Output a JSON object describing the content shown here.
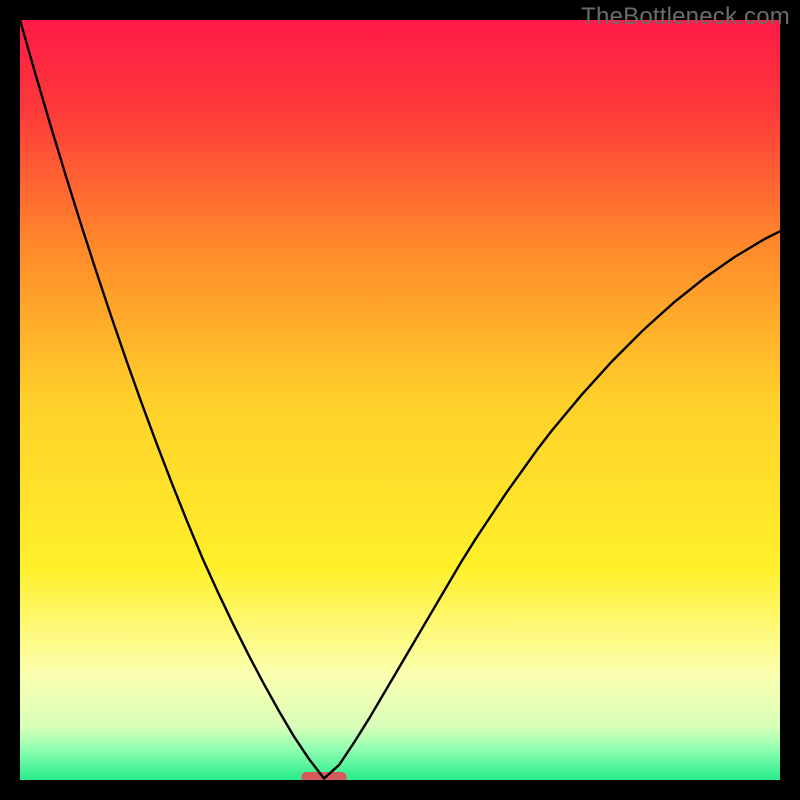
{
  "watermark": "TheBottleneck.com",
  "chart_data": {
    "type": "line",
    "title": "",
    "xlabel": "",
    "ylabel": "",
    "xlim": [
      0,
      100
    ],
    "ylim": [
      0,
      100
    ],
    "grid": false,
    "background": {
      "description": "vertical gradient red→orange→yellow→pale→green (top→bottom)",
      "stops": [
        {
          "pct": 0,
          "color": "#ff1a47"
        },
        {
          "pct": 12,
          "color": "#ff3a3a"
        },
        {
          "pct": 30,
          "color": "#ff8a2a"
        },
        {
          "pct": 50,
          "color": "#ffd02a"
        },
        {
          "pct": 72,
          "color": "#fff02a"
        },
        {
          "pct": 86,
          "color": "#fcffb0"
        },
        {
          "pct": 93,
          "color": "#d8ffb9"
        },
        {
          "pct": 96,
          "color": "#8effb0"
        },
        {
          "pct": 100,
          "color": "#28ec8c"
        }
      ]
    },
    "cusp_marker": {
      "x": 40,
      "y": 0,
      "width": 6,
      "color": "#d85a5a",
      "shape": "rounded-dash"
    },
    "series": [
      {
        "name": "bottleneck-curve",
        "color": "#000000",
        "points": [
          {
            "x": 0.0,
            "y": 100.0
          },
          {
            "x": 2.0,
            "y": 93.0
          },
          {
            "x": 4.0,
            "y": 86.2
          },
          {
            "x": 6.0,
            "y": 79.6
          },
          {
            "x": 8.0,
            "y": 73.2
          },
          {
            "x": 10.0,
            "y": 67.0
          },
          {
            "x": 12.0,
            "y": 61.0
          },
          {
            "x": 14.0,
            "y": 55.2
          },
          {
            "x": 16.0,
            "y": 49.6
          },
          {
            "x": 18.0,
            "y": 44.2
          },
          {
            "x": 20.0,
            "y": 39.0
          },
          {
            "x": 22.0,
            "y": 34.0
          },
          {
            "x": 24.0,
            "y": 29.2
          },
          {
            "x": 26.0,
            "y": 24.8
          },
          {
            "x": 28.0,
            "y": 20.6
          },
          {
            "x": 30.0,
            "y": 16.6
          },
          {
            "x": 32.0,
            "y": 12.8
          },
          {
            "x": 34.0,
            "y": 9.2
          },
          {
            "x": 36.0,
            "y": 5.8
          },
          {
            "x": 38.0,
            "y": 2.8
          },
          {
            "x": 40.0,
            "y": 0.2
          },
          {
            "x": 42.0,
            "y": 2.0
          },
          {
            "x": 44.0,
            "y": 5.0
          },
          {
            "x": 46.0,
            "y": 8.2
          },
          {
            "x": 48.0,
            "y": 11.6
          },
          {
            "x": 50.0,
            "y": 15.0
          },
          {
            "x": 52.0,
            "y": 18.4
          },
          {
            "x": 54.0,
            "y": 21.8
          },
          {
            "x": 56.0,
            "y": 25.2
          },
          {
            "x": 58.0,
            "y": 28.6
          },
          {
            "x": 60.0,
            "y": 31.8
          },
          {
            "x": 62.0,
            "y": 34.8
          },
          {
            "x": 64.0,
            "y": 37.8
          },
          {
            "x": 66.0,
            "y": 40.6
          },
          {
            "x": 68.0,
            "y": 43.4
          },
          {
            "x": 70.0,
            "y": 46.0
          },
          {
            "x": 72.0,
            "y": 48.4
          },
          {
            "x": 74.0,
            "y": 50.8
          },
          {
            "x": 76.0,
            "y": 53.0
          },
          {
            "x": 78.0,
            "y": 55.2
          },
          {
            "x": 80.0,
            "y": 57.2
          },
          {
            "x": 82.0,
            "y": 59.2
          },
          {
            "x": 84.0,
            "y": 61.0
          },
          {
            "x": 86.0,
            "y": 62.8
          },
          {
            "x": 88.0,
            "y": 64.4
          },
          {
            "x": 90.0,
            "y": 66.0
          },
          {
            "x": 92.0,
            "y": 67.4
          },
          {
            "x": 94.0,
            "y": 68.8
          },
          {
            "x": 96.0,
            "y": 70.0
          },
          {
            "x": 98.0,
            "y": 71.2
          },
          {
            "x": 100.0,
            "y": 72.2
          }
        ]
      }
    ]
  }
}
